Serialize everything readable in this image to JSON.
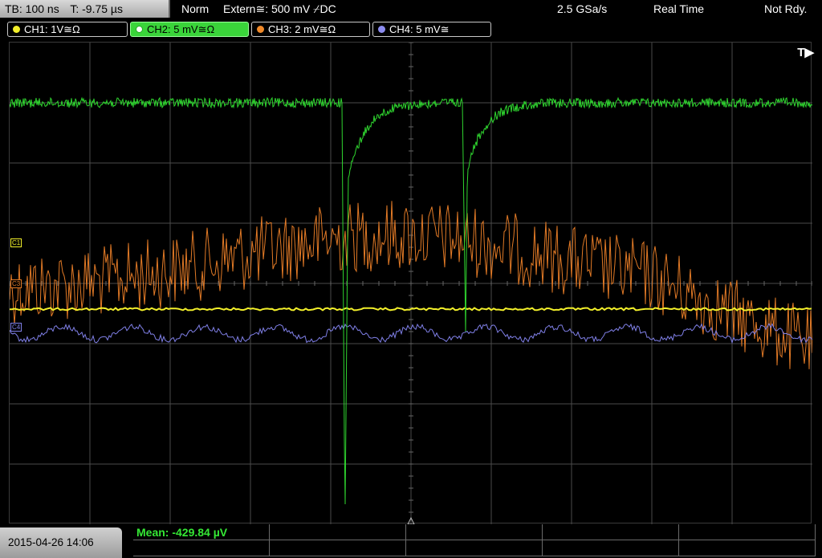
{
  "top": {
    "timebase": "TB: 100 ns",
    "trigger_time": "T: -9.75 µs",
    "mode": "Norm",
    "trigger_source": "Extern≅: 500 mV ⌿DC",
    "sample_rate": "2.5 GSa/s",
    "acq_mode": "Real Time",
    "status": "Not Rdy."
  },
  "channels": [
    {
      "label": "CH1: 1V≅Ω",
      "color": "#f2ef2a",
      "active": false
    },
    {
      "label": "CH2: 5 mV≅Ω",
      "color": "#3ad43a",
      "active": true
    },
    {
      "label": "CH3: 2 mV≅Ω",
      "color": "#f08a2a",
      "active": false
    },
    {
      "label": "CH4: 5 mV≅",
      "color": "#8c8cf0",
      "active": false
    }
  ],
  "markers": {
    "c1": "C1",
    "c3": "C3",
    "c4": "C4"
  },
  "trigger_indicator": "T▶",
  "measurement": {
    "label": "Mean: -429.84 µV"
  },
  "datetime": "2015-04-26 14:06",
  "colors": {
    "ch1": "#f2ef2a",
    "ch2": "#2fd52f",
    "ch3": "#e27a26",
    "ch4": "#8080e8",
    "grid": "#4a4a4a"
  }
}
